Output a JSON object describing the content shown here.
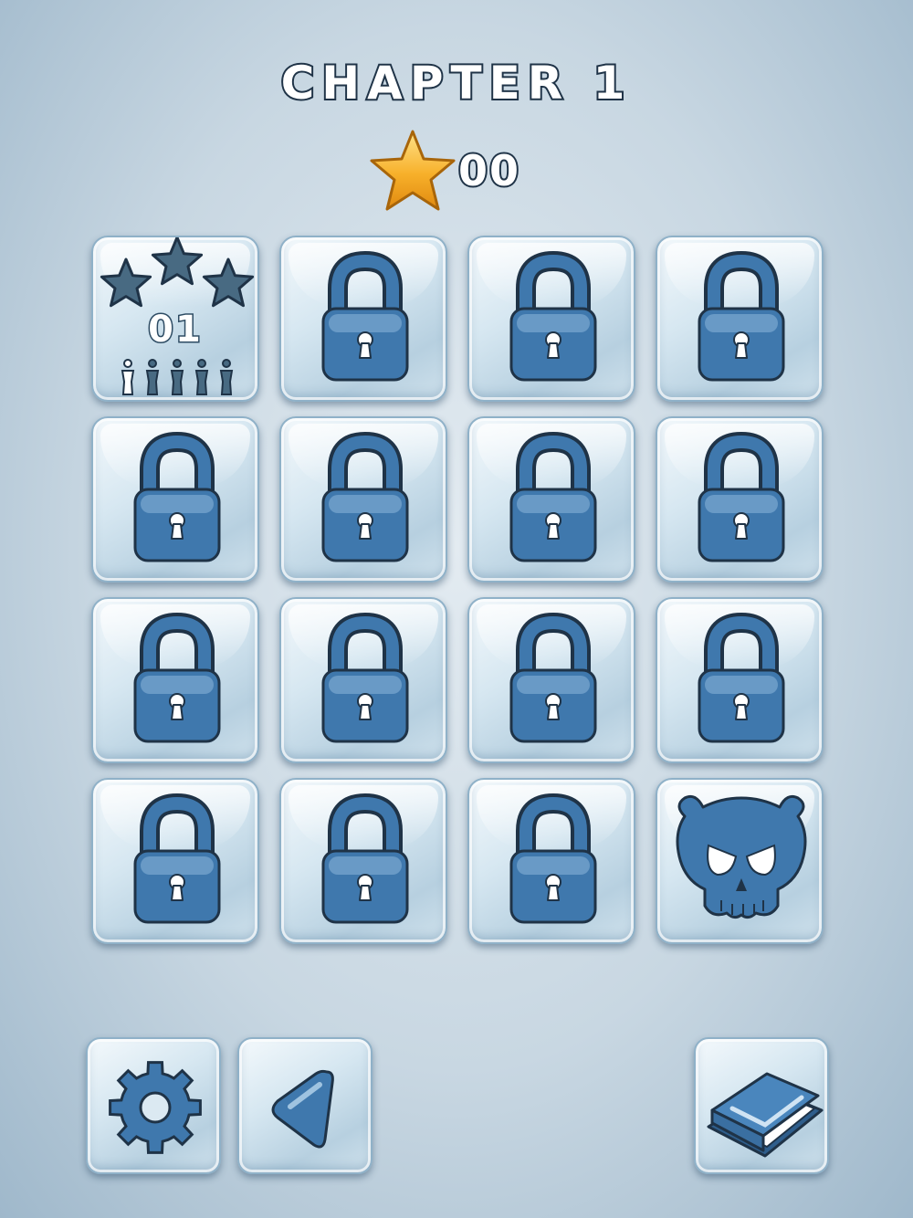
{
  "header": {
    "title": "CHAPTER 1",
    "star_icon": "star-icon",
    "star_total": "00"
  },
  "levels": [
    {
      "state": "unlocked",
      "number": "01",
      "stars_earned": 0,
      "people_rescued": 1,
      "people_total": 5
    },
    {
      "state": "locked",
      "icon": "lock-icon"
    },
    {
      "state": "locked",
      "icon": "lock-icon"
    },
    {
      "state": "locked",
      "icon": "lock-icon"
    },
    {
      "state": "locked",
      "icon": "lock-icon"
    },
    {
      "state": "locked",
      "icon": "lock-icon"
    },
    {
      "state": "locked",
      "icon": "lock-icon"
    },
    {
      "state": "locked",
      "icon": "lock-icon"
    },
    {
      "state": "locked",
      "icon": "lock-icon"
    },
    {
      "state": "locked",
      "icon": "lock-icon"
    },
    {
      "state": "locked",
      "icon": "lock-icon"
    },
    {
      "state": "locked",
      "icon": "lock-icon"
    },
    {
      "state": "locked",
      "icon": "lock-icon"
    },
    {
      "state": "locked",
      "icon": "lock-icon"
    },
    {
      "state": "locked",
      "icon": "lock-icon"
    },
    {
      "state": "boss",
      "icon": "skull-icon"
    }
  ],
  "footer": {
    "settings_icon": "gear-icon",
    "back_icon": "back-arrow-icon",
    "book_icon": "book-icon"
  },
  "colors": {
    "icon_blue": "#3f78ad",
    "icon_outline": "#1f3347",
    "star_gold": "#f7a823",
    "star_empty": "#486a82"
  }
}
